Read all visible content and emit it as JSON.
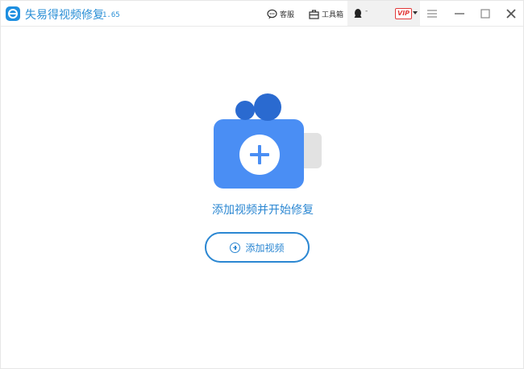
{
  "app": {
    "title": "失易得视频修复",
    "version": "1.65",
    "accent_color": "#2b87d2"
  },
  "toolbar": {
    "service_label": "客服",
    "service_icon": "chat-icon",
    "toolbox_label": "工具箱",
    "toolbox_icon": "toolbox-icon"
  },
  "account": {
    "icon": "penguin-icon",
    "name": "-",
    "vip_label": "VIP"
  },
  "window_controls": [
    "menu-icon",
    "minimize-icon",
    "maximize-icon",
    "close-icon"
  ],
  "main": {
    "illustration_icon": "video-camera-add-icon",
    "prompt": "添加视频并开始修复",
    "add_button_label": "添加视频"
  }
}
